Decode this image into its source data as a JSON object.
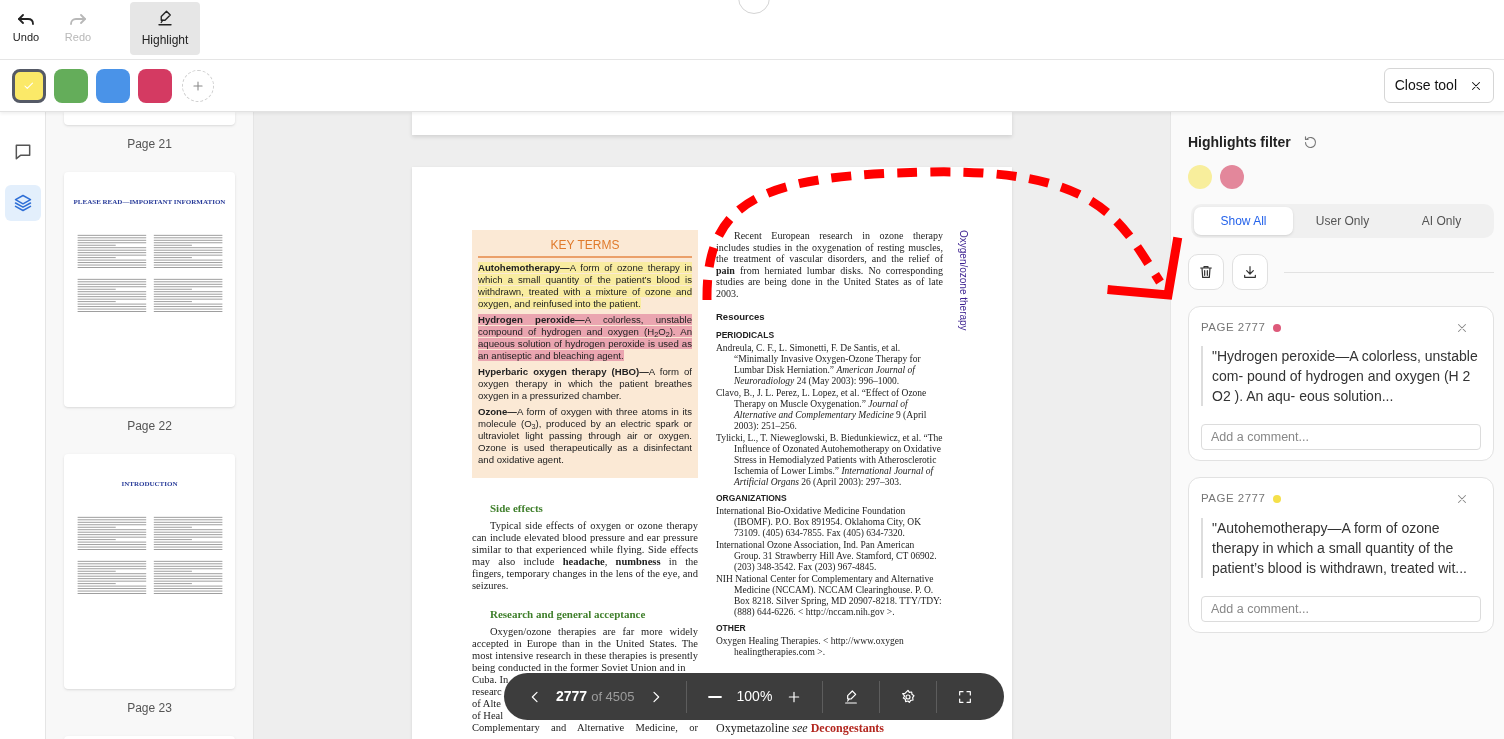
{
  "history": [
    {
      "kind": "undo",
      "label": "Undo",
      "disabled": false
    },
    {
      "kind": "redo",
      "label": "Redo",
      "disabled": true
    }
  ],
  "tool": {
    "label": "Highlight",
    "selected": true
  },
  "swatches": [
    {
      "color": "#fbe968",
      "selected": true
    },
    {
      "color": "#64ad5a",
      "selected": false
    },
    {
      "color": "#4a93e8",
      "selected": false
    },
    {
      "color": "#d43a62",
      "selected": false
    }
  ],
  "close_button": "Close tool",
  "rail": [
    {
      "kind": "comments",
      "selected": false
    },
    {
      "kind": "layers",
      "selected": true
    }
  ],
  "thumbnails": [
    {
      "kind": "tail",
      "label": "Page 21"
    },
    {
      "kind": "full",
      "heading": "PLEASE READ—IMPORTANT INFORMATION",
      "label": "Page 22"
    },
    {
      "kind": "full",
      "heading": "INTRODUCTION",
      "label": "Page 23"
    },
    {
      "kind": "top"
    }
  ],
  "document": {
    "side_title": "Oxygen/ozone therapy",
    "key_terms": {
      "title": "KEY TERMS",
      "entries": [
        {
          "text": "**Autohemotherapy—**A form of ozone therapy in which a small quantity of the patient’s blood is withdrawn, treated with a mixture of ozone and oxygen, and reinfused into the patient.",
          "color": "#f9eca0"
        },
        {
          "text": "**Hydrogen peroxide—**A colorless, unstable compound of hydrogen and oxygen (H$_{2}$O$_{2}$). An aqueous solution of hydrogen peroxide is used as an antiseptic and bleaching agent.",
          "color": "#eaa5b0"
        },
        {
          "text": "**Hyperbaric oxygen therapy (HBO)—**A form of oxygen therapy in which the patient breathes oxygen in a pressurized chamber."
        },
        {
          "text": "**Ozone—**A form of oxygen with three atoms in its molecule (O$_{3}$), produced by an electric spark or ultraviolet light passing through air or oxygen. Ozone is used therapeutically as a disinfectant and oxidative agent."
        }
      ]
    },
    "left_column": [
      {
        "kind": "heading",
        "text": "Side effects"
      },
      {
        "kind": "paragraph",
        "text": "Typical side effects of oxygen or ozone therapy can include elevated blood pressure and ear pressure similar to that experienced while flying. Side effects may also include **headache**, **numbness** in the fingers, temporary changes in the lens of the eye, and seizures."
      },
      {
        "kind": "heading",
        "text": "Research and general acceptance"
      },
      {
        "kind": "paragraph",
        "text": "Oxygen/ozone therapies are far more widely accepted in Europe than in the United States. The most intensive research in these therapies is presently being conducted in the former Soviet Union and in"
      },
      {
        "kind": "fragment",
        "text": "Cuba. In"
      },
      {
        "kind": "fragment",
        "text": "researc"
      },
      {
        "kind": "fragment",
        "text": "of Alte"
      },
      {
        "kind": "fragment",
        "text": "of Heal"
      },
      {
        "kind": "line",
        "text": "Complementary and Alternative Medicine, or"
      }
    ],
    "right_column": [
      {
        "kind": "paragraph",
        "text": "Recent European research in ozone therapy includes studies in the oxygenation of resting muscles, the treatment of vascular disorders, and the relief of **pain** from herniated lumbar disks. No corresponding studies are being done in the United States as of late 2003."
      },
      {
        "kind": "heading",
        "text": "Resources"
      },
      {
        "kind": "subheading",
        "text": "PERIODICALS"
      },
      {
        "kind": "reference",
        "text": "Andreula, C. F., L. Simonetti, F. De Santis, et al. “Minimally Invasive Oxygen-Ozone Therapy for Lumbar Disk Herniation.” *American Journal of Neuroradiology* 24 (May 2003): 996–1000."
      },
      {
        "kind": "reference",
        "text": "Clavo, B., J. L. Perez, L. Lopez, et al. “Effect of Ozone Therapy on Muscle Oxygenation.” *Journal of Alternative and Complementary Medicine* 9 (April 2003): 251–256."
      },
      {
        "kind": "reference",
        "text": "Tylicki, L., T. Nieweglowski, B. Biedunkiewicz, et al. “The Influence of Ozonated Autohemotherapy on Oxidative Stress in Hemodialyzed Patients with Atherosclerotic Ischemia of Lower Limbs.” *International Journal of Artificial Organs* 26 (April 2003): 297–303."
      },
      {
        "kind": "subheading",
        "text": "ORGANIZATIONS"
      },
      {
        "kind": "reference",
        "text": "International Bio-Oxidative Medicine Foundation (IBOMF). P.O. Box 891954. Oklahoma City, OK 73109. (405) 634-7855. Fax (405) 634-7320."
      },
      {
        "kind": "reference",
        "text": "International Ozone Association, Ind. Pan American Group. 31 Strawberry Hill Ave. Stamford, CT 06902. (203) 348-3542. Fax (203) 967-4845."
      },
      {
        "kind": "reference",
        "text": "NIH National Center for Complementary and Alternative Medicine (NCCAM). NCCAM Clearinghouse. P. O. Box 8218. Silver Spring, MD 20907-8218. TTY/TDY: (888) 644-6226. < http://nccam.nih.gov >."
      },
      {
        "kind": "subheading",
        "text": "OTHER"
      },
      {
        "kind": "reference",
        "text": "Oxygen Healing Therapies. < http://www.oxygen healingtherapies.com >."
      },
      {
        "kind": "see_also",
        "term": "Oxymetazoline",
        "see": "see",
        "target": "Decongestants"
      }
    ]
  },
  "annotation": {
    "kind": "dashed_arrow"
  },
  "pager": {
    "current": "2777",
    "total": "of 4505",
    "zoom": "100%"
  },
  "highlights_panel": {
    "title": "Highlights filter",
    "colors": [
      {
        "color": "#f8ee9c"
      },
      {
        "color": "#e3879b"
      }
    ],
    "filters": [
      {
        "label": "Show All",
        "selected": true
      },
      {
        "label": "User Only",
        "selected": false
      },
      {
        "label": "AI Only",
        "selected": false
      }
    ],
    "cards": [
      {
        "page": "PAGE 2777",
        "color": "#dd5a7a",
        "quote": "\"Hydrogen peroxide—A colorless, unstable com- pound of hydrogen and oxygen (H 2 O2 ). An aqu- eous solution...",
        "placeholder": "Add a comment..."
      },
      {
        "page": "PAGE 2777",
        "color": "#f5e04a",
        "quote": "\"Autohemotherapy—A form of ozone therapy in which a small quantity of the patient’s blood is withdrawn, treated wit...",
        "placeholder": "Add a comment..."
      }
    ]
  }
}
